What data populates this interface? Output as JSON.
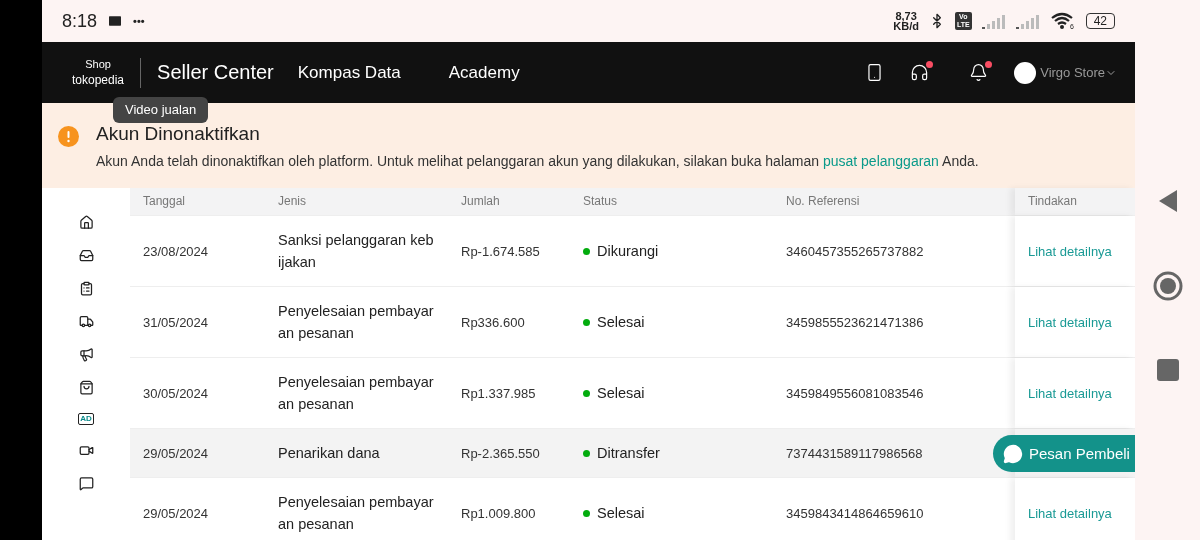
{
  "status_bar": {
    "time": "8:18",
    "more": "•••",
    "net_speed": [
      "8,73",
      "KB/d"
    ],
    "volte": [
      "Vo",
      "LTE"
    ],
    "wifi_gen": "6",
    "battery": "42"
  },
  "header": {
    "logo_top": "Shop",
    "logo_bottom": "tokopedia",
    "title": "Seller Center",
    "nav": [
      "Kompas Data",
      "Academy"
    ],
    "support_dot": true,
    "bell_dot": true,
    "store_name": "Virgo Store"
  },
  "tooltip": "Video jualan",
  "banner": {
    "title": "Akun Dinonaktifkan",
    "message_before": "Akun Anda telah dinonaktifkan oleh platform. Untuk melihat pelanggaran akun yang dilakukan, silakan buka halaman ",
    "link": "pusat pelanggaran",
    "message_after": " Anda."
  },
  "sidebar": {
    "items": [
      {
        "kind": "home"
      },
      {
        "kind": "inbox"
      },
      {
        "kind": "orders"
      },
      {
        "kind": "shipping"
      },
      {
        "kind": "promo"
      },
      {
        "kind": "products"
      },
      {
        "kind": "ads",
        "label": "AD"
      },
      {
        "kind": "video"
      },
      {
        "kind": "help"
      }
    ]
  },
  "table": {
    "columns": [
      "Tanggal",
      "Jenis",
      "Jumlah",
      "Status",
      "No. Referensi",
      "Tindakan"
    ],
    "rows": [
      {
        "date": "23/08/2024",
        "type_lines": [
          "Sanksi pelanggaran keb",
          "ijakan"
        ],
        "amount": "Rp-1.674.585",
        "status": "Dikurangi",
        "color": "#03ac0e",
        "reference": "3460457355265737882",
        "action": "Lihat detailnya",
        "hovered": false
      },
      {
        "date": "31/05/2024",
        "type_lines": [
          "Penyelesaian pembayar",
          "an pesanan"
        ],
        "amount": "Rp336.600",
        "status": "Selesai",
        "color": "#03ac0e",
        "reference": "3459855523621471386",
        "action": "Lihat detailnya",
        "hovered": false
      },
      {
        "date": "30/05/2024",
        "type_lines": [
          "Penyelesaian pembayar",
          "an pesanan"
        ],
        "amount": "Rp1.337.985",
        "status": "Selesai",
        "color": "#03ac0e",
        "reference": "3459849556081083546",
        "action": "Lihat detailnya",
        "hovered": false
      },
      {
        "date": "29/05/2024",
        "type_lines": [
          "Penarikan dana"
        ],
        "amount": "Rp-2.365.550",
        "status": "Ditransfer",
        "color": "#03ac0e",
        "reference": "7374431589117986568",
        "hovered": true
      },
      {
        "date": "29/05/2024",
        "type_lines": [
          "Penyelesaian pembayar",
          "an pesanan"
        ],
        "amount": "Rp1.009.800",
        "status": "Selesai",
        "color": "#03ac0e",
        "reference": "3459843414864659610",
        "action": "Lihat detailnya",
        "hovered": false
      }
    ]
  },
  "chat_button": "Pesan Pembeli"
}
